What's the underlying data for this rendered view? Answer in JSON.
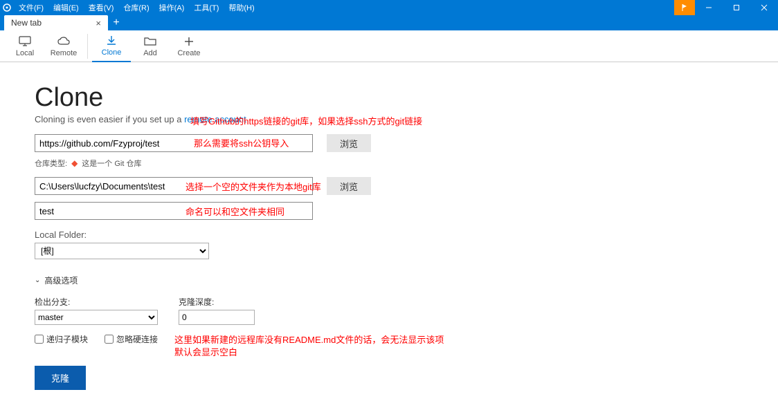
{
  "menu": {
    "items": [
      "文件(F)",
      "编辑(E)",
      "查看(V)",
      "仓库(R)",
      "操作(A)",
      "工具(T)",
      "帮助(H)"
    ]
  },
  "tab": {
    "title": "New tab"
  },
  "toolbar": {
    "local": "Local",
    "remote": "Remote",
    "clone": "Clone",
    "add": "Add",
    "create": "Create"
  },
  "page": {
    "title": "Clone",
    "subtitle_pre": "Cloning is even easier if you set up a ",
    "subtitle_link": "remote account"
  },
  "fields": {
    "source_url": "https://github.com/Fzyproj/test",
    "browse": "浏览",
    "repo_type_label": "仓库类型:",
    "repo_type_value": "这是一个 Git 仓库",
    "dest_path": "C:\\Users\\lucfzy\\Documents\\test",
    "name": "test",
    "local_folder_label": "Local Folder:",
    "local_folder_value": "[根]"
  },
  "advanced": {
    "toggle": "高级选项",
    "checkout_label": "检出分支:",
    "checkout_value": "master",
    "depth_label": "克隆深度:",
    "depth_value": "0",
    "recurse": "递归子模块",
    "nohardlinks": "忽略硬连接"
  },
  "annotations": {
    "a1": "填写Github的https链接的git库，如果选择ssh方式的git链接",
    "a2": "那么需要将ssh公钥导入",
    "a3": "选择一个空的文件夹作为本地git库",
    "a4": "命名可以和空文件夹相同",
    "a5": "这里如果新建的远程库没有README.md文件的话，会无法显示该项",
    "a6": "默认会显示空白"
  },
  "buttons": {
    "clone": "克隆"
  }
}
